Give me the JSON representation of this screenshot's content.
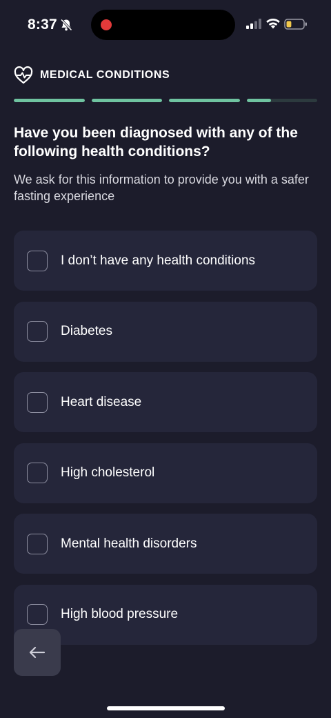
{
  "status_bar": {
    "time": "8:37",
    "battery_level": 0.3,
    "battery_color": "#f2c94c",
    "recording_color": "#e23a3a"
  },
  "header": {
    "icon": "heart-pulse-icon",
    "section_label": "MEDICAL CONDITIONS"
  },
  "progress": {
    "segments": [
      1,
      1,
      1,
      0.35
    ],
    "color": "#6fc3a0"
  },
  "question": {
    "title": "Have you been diagnosed with any of the following health conditions?",
    "subtitle": "We ask for this information to provide you with a safer fasting experience"
  },
  "options": [
    {
      "label": "I don’t have any health conditions",
      "checked": false
    },
    {
      "label": "Diabetes",
      "checked": false
    },
    {
      "label": "Heart disease",
      "checked": false
    },
    {
      "label": "High cholesterol",
      "checked": false
    },
    {
      "label": "Mental health disorders",
      "checked": false
    },
    {
      "label": "High blood pressure",
      "checked": false
    }
  ],
  "nav": {
    "back_icon": "arrow-left-icon"
  }
}
